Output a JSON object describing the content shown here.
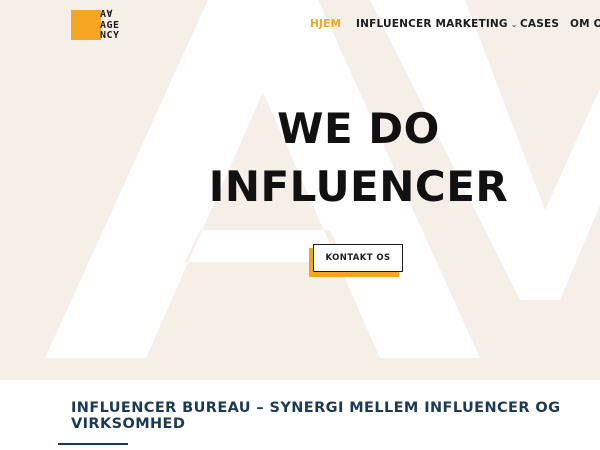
{
  "brand": {
    "logo_lines": [
      "A∀",
      "AGE",
      "NCY"
    ],
    "accent_color": "#f4a623",
    "text_color": "#1c1c1c"
  },
  "nav": {
    "items": [
      {
        "label": "HJEM",
        "active": true
      },
      {
        "label": "INFLUENCER MARKETING",
        "has_dropdown": true
      },
      {
        "label": "CASES"
      },
      {
        "label": "OM O"
      }
    ]
  },
  "hero": {
    "headline_line1": "WE DO",
    "headline_line2": "INFLUENCER",
    "background_color": "#f6efe8",
    "background_watermark_icon": "av-logo-watermark",
    "cta_label": "KONTAKT OS"
  },
  "section": {
    "title": "INFLUENCER BUREAU – SYNERGI MELLEM INFLUENCER OG VIRKSOMHED",
    "title_color": "#1b3a57"
  }
}
